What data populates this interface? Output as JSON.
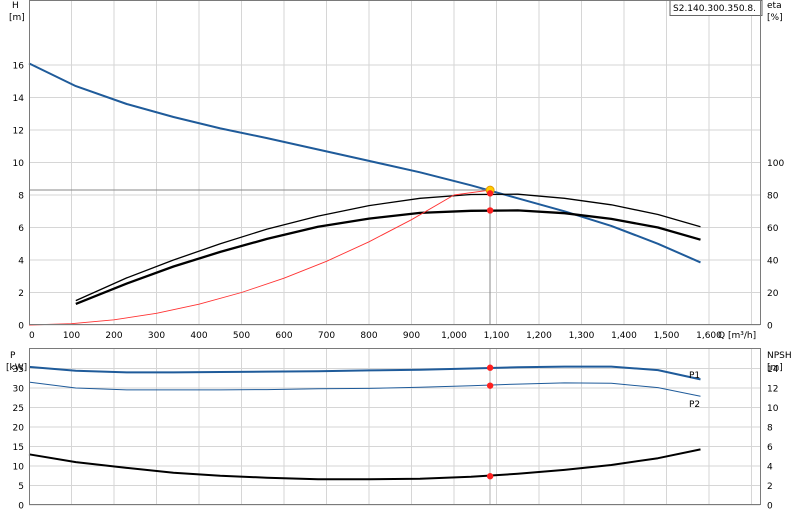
{
  "chart_data": [
    {
      "type": "line",
      "model_label": "S2.140.300.350.8.",
      "xlabel": "Q [m³/h]",
      "x_ticks": [
        "0",
        "100",
        "200",
        "300",
        "400",
        "500",
        "600",
        "700",
        "800",
        "900",
        "1,000",
        "1,100",
        "1,200",
        "1,300",
        "1,400",
        "1,500",
        "1,600"
      ],
      "xlim": [
        0,
        1720
      ],
      "left_axis": {
        "label_top": "H",
        "unit": "[m]",
        "ylim": [
          0,
          20
        ],
        "ticks": [
          "0",
          "2",
          "4",
          "6",
          "8",
          "10",
          "12",
          "14",
          "16"
        ]
      },
      "right_axis": {
        "label_top": "eta",
        "unit": "[%]",
        "ylim": [
          0,
          200
        ],
        "ticks": [
          "0",
          "20",
          "40",
          "60",
          "80",
          "100"
        ]
      },
      "series": [
        {
          "id": "head",
          "axis": "left",
          "color": "#1f5b9a",
          "width": 2,
          "x": [
            0,
            110,
            230,
            340,
            450,
            560,
            680,
            800,
            920,
            1040,
            1150,
            1260,
            1370,
            1480,
            1580
          ],
          "y": [
            16.1,
            14.7,
            13.6,
            12.8,
            12.1,
            11.5,
            10.8,
            10.1,
            9.4,
            8.6,
            7.8,
            7.0,
            6.1,
            5.0,
            3.85
          ]
        },
        {
          "id": "eta_p1",
          "axis": "right",
          "color": "#000000",
          "width": 1.3,
          "x": [
            110,
            230,
            340,
            450,
            560,
            680,
            800,
            920,
            1040,
            1150,
            1260,
            1370,
            1480,
            1580
          ],
          "y": [
            15,
            29,
            40,
            50,
            59,
            67,
            73.5,
            78,
            80.3,
            80.5,
            78,
            74,
            68,
            60.5
          ]
        },
        {
          "id": "eta_p2",
          "axis": "right",
          "color": "#000000",
          "width": 2.3,
          "x": [
            110,
            230,
            340,
            450,
            560,
            680,
            800,
            920,
            1040,
            1150,
            1260,
            1370,
            1480,
            1580
          ],
          "y": [
            13,
            25.5,
            36,
            45,
            53,
            60.5,
            65.5,
            69,
            70.3,
            70.5,
            68.8,
            65.3,
            60,
            52.5
          ]
        },
        {
          "id": "system",
          "axis": "left",
          "color": "#ff3333",
          "width": 0.9,
          "x": [
            0,
            100,
            200,
            300,
            400,
            500,
            600,
            700,
            800,
            900,
            1000,
            1085
          ],
          "y": [
            0,
            0.08,
            0.32,
            0.72,
            1.28,
            2.0,
            2.88,
            3.92,
            5.12,
            6.48,
            8.0,
            8.3
          ]
        }
      ],
      "op_markers": [
        {
          "x": 1085,
          "y": 8.1,
          "axis": "left"
        },
        {
          "x": 1085,
          "y": 7.05,
          "axis": "left"
        }
      ],
      "op_highlight": {
        "x": 1085,
        "y": 8.3,
        "axis": "left"
      },
      "op_point": {
        "x": 1085,
        "y": 8.3
      }
    },
    {
      "type": "line",
      "left_axis": {
        "label_top": "P",
        "unit": "[kW]",
        "ylim": [
          0,
          40
        ],
        "ticks": [
          "0",
          "5",
          "10",
          "15",
          "20",
          "25",
          "30",
          "35"
        ]
      },
      "right_axis": {
        "label_top": "NPSH",
        "unit": "[m]",
        "ylim": [
          0,
          16
        ],
        "ticks": [
          "0",
          "2",
          "4",
          "6",
          "8",
          "10",
          "12",
          "14"
        ]
      },
      "series": [
        {
          "id": "P1",
          "name": "P1",
          "axis": "left",
          "color": "#1f5b9a",
          "width": 2,
          "x": [
            0,
            110,
            230,
            340,
            450,
            560,
            680,
            800,
            920,
            1040,
            1150,
            1260,
            1370,
            1480,
            1580
          ],
          "y": [
            35.4,
            34.4,
            34.0,
            34.0,
            34.1,
            34.2,
            34.3,
            34.5,
            34.7,
            35.0,
            35.3,
            35.5,
            35.5,
            34.6,
            32.2
          ]
        },
        {
          "id": "P2",
          "name": "P2",
          "axis": "left",
          "color": "#1f5b9a",
          "width": 1,
          "x": [
            0,
            110,
            230,
            340,
            450,
            560,
            680,
            800,
            920,
            1040,
            1150,
            1260,
            1370,
            1480,
            1580
          ],
          "y": [
            31.5,
            30.0,
            29.5,
            29.5,
            29.5,
            29.6,
            29.8,
            29.9,
            30.2,
            30.6,
            31.0,
            31.3,
            31.2,
            30.1,
            27.9
          ]
        },
        {
          "id": "NPSH",
          "axis": "right",
          "color": "#000000",
          "width": 2,
          "x": [
            0,
            110,
            230,
            340,
            450,
            560,
            680,
            800,
            920,
            1040,
            1150,
            1260,
            1370,
            1480,
            1580
          ],
          "y": [
            5.2,
            4.4,
            3.8,
            3.3,
            3.0,
            2.8,
            2.65,
            2.65,
            2.7,
            2.9,
            3.2,
            3.6,
            4.1,
            4.8,
            5.7
          ]
        }
      ],
      "op_markers": [
        {
          "x": 1085,
          "y": 35.2,
          "axis": "left"
        },
        {
          "x": 1085,
          "y": 30.6,
          "axis": "left"
        },
        {
          "x": 1085,
          "y": 2.95,
          "axis": "right"
        }
      ]
    }
  ]
}
